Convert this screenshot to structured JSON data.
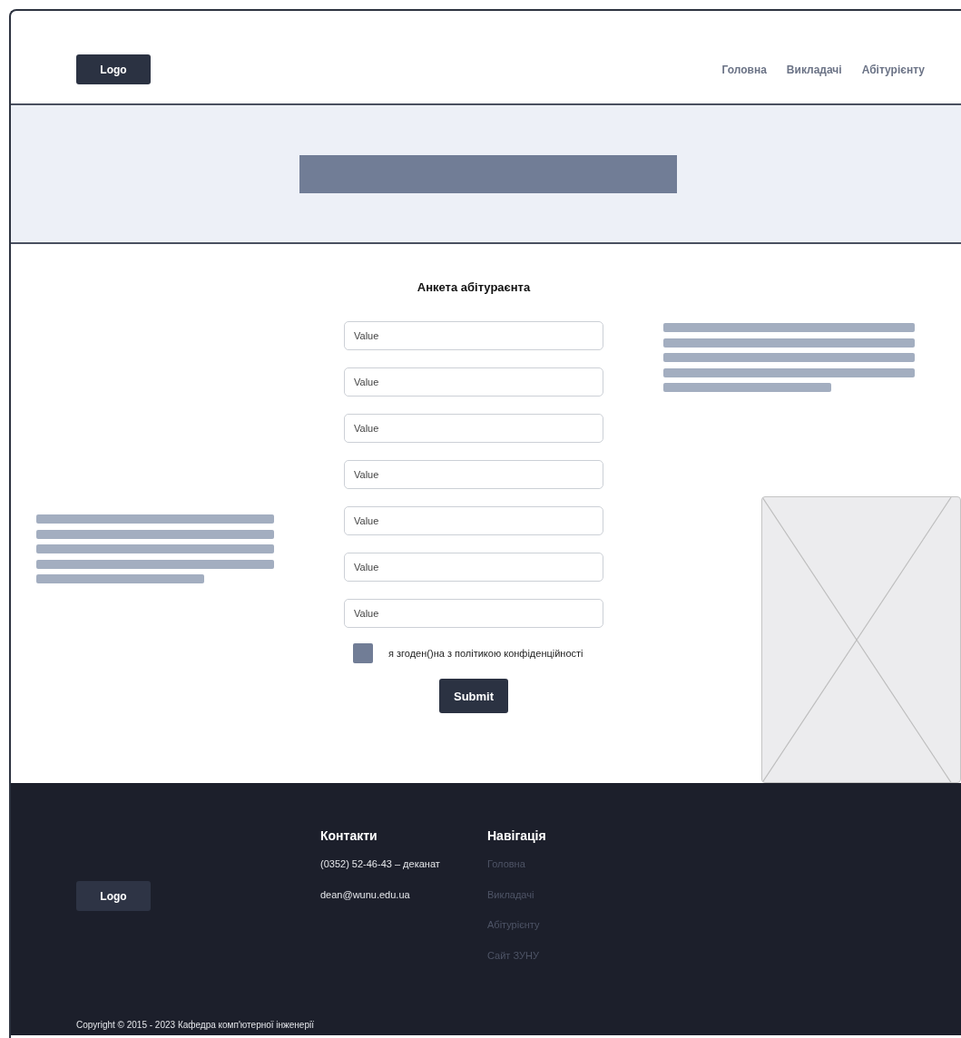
{
  "header": {
    "logo": "Logo",
    "nav": [
      {
        "label": "Головна"
      },
      {
        "label": "Викладачі"
      },
      {
        "label": "Абітурієнту"
      }
    ]
  },
  "form": {
    "title": "Анкета абітураєнта",
    "fields": [
      {
        "placeholder": "Value"
      },
      {
        "placeholder": "Value"
      },
      {
        "placeholder": "Value"
      },
      {
        "placeholder": "Value"
      },
      {
        "placeholder": "Value"
      },
      {
        "placeholder": "Value"
      },
      {
        "placeholder": "Value"
      }
    ],
    "consent": "я згоден()на з політикою конфіденційності",
    "consent_checked": false,
    "submit": "Submit"
  },
  "footer": {
    "logo": "Logo",
    "contacts": {
      "heading": "Контакти",
      "items": [
        "(0352) 52-46-43 – деканат",
        "dean@wunu.edu.ua"
      ]
    },
    "navigation": {
      "heading": "Навігація",
      "items": [
        "Головна",
        "Викладачі",
        "Абітурієнту",
        "Сайт ЗУНУ"
      ]
    },
    "copyright": "Copyright © 2015 - 2023 Кафедра комп'ютерної інженерії"
  }
}
